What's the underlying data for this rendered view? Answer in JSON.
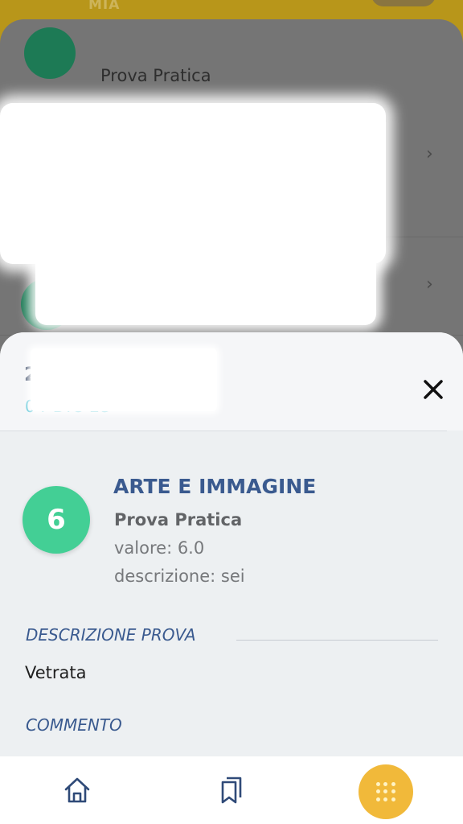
{
  "background": {
    "header_text": "MIA",
    "row_label": "Prova Pratica"
  },
  "sheet": {
    "title_glyph": "2",
    "date": "04 DIC 23",
    "grade": "6",
    "subject": "ARTE E IMMAGINE",
    "type": "Prova Pratica",
    "valore": "valore: 6.0",
    "descrizione": "descrizione: sei",
    "section_description_label": "DESCRIZIONE PROVA",
    "section_description_text": "Vetrata",
    "section_comment_label": "COMMENTO"
  },
  "nav": {
    "home_icon": "home-icon",
    "bookmarks_icon": "bookmarks-icon",
    "menu_icon": "grid-menu-icon"
  },
  "colors": {
    "accent_blue": "#3a5a8f",
    "grade_green": "#43cf95",
    "date_cyan": "#4ec3d6",
    "fab_yellow": "#f1b93a"
  }
}
